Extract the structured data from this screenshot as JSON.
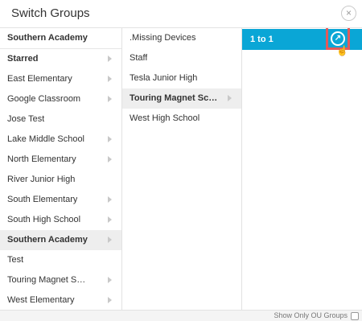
{
  "dialog": {
    "title": "Switch Groups",
    "close_symbol": "×"
  },
  "column1": {
    "items": [
      {
        "label": "Southern Academy",
        "bold": true,
        "chevron": false,
        "selected": false
      },
      {
        "label": "Starred",
        "bold": true,
        "chevron": true,
        "selected": false
      },
      {
        "label": "East Elementary",
        "bold": false,
        "chevron": true,
        "selected": false
      },
      {
        "label": "Google Classroom",
        "bold": false,
        "chevron": true,
        "selected": false
      },
      {
        "label": "Jose Test",
        "bold": false,
        "chevron": false,
        "selected": false
      },
      {
        "label": "Lake Middle School",
        "bold": false,
        "chevron": true,
        "selected": false
      },
      {
        "label": "North Elementary",
        "bold": false,
        "chevron": true,
        "selected": false
      },
      {
        "label": "River Junior High",
        "bold": false,
        "chevron": false,
        "selected": false
      },
      {
        "label": "South Elementary",
        "bold": false,
        "chevron": true,
        "selected": false
      },
      {
        "label": "South High School",
        "bold": false,
        "chevron": true,
        "selected": false
      },
      {
        "label": "Southern Academy",
        "bold": true,
        "chevron": true,
        "selected": true
      },
      {
        "label": "Test",
        "bold": false,
        "chevron": false,
        "selected": false
      },
      {
        "label": "Touring Magnet School",
        "bold": false,
        "chevron": true,
        "selected": false
      },
      {
        "label": "West Elementary",
        "bold": false,
        "chevron": true,
        "selected": false
      }
    ]
  },
  "column2": {
    "items": [
      {
        "label": ".Missing Devices",
        "bold": false,
        "chevron": false,
        "selected": false
      },
      {
        "label": "Staff",
        "bold": false,
        "chevron": false,
        "selected": false
      },
      {
        "label": "Tesla Junior High",
        "bold": false,
        "chevron": false,
        "selected": false
      },
      {
        "label": "Touring Magnet Sch…",
        "bold": true,
        "chevron": true,
        "selected": true
      },
      {
        "label": "West High School",
        "bold": false,
        "chevron": false,
        "selected": false
      }
    ]
  },
  "column3": {
    "active_item": "1 to 1",
    "launch_icon": "↗"
  },
  "footer": {
    "show_only_ou_label": "Show Only OU Groups",
    "show_only_ou_checked": false
  },
  "colors": {
    "accent": "#0aa6d6",
    "highlight": "#e25a5a"
  }
}
